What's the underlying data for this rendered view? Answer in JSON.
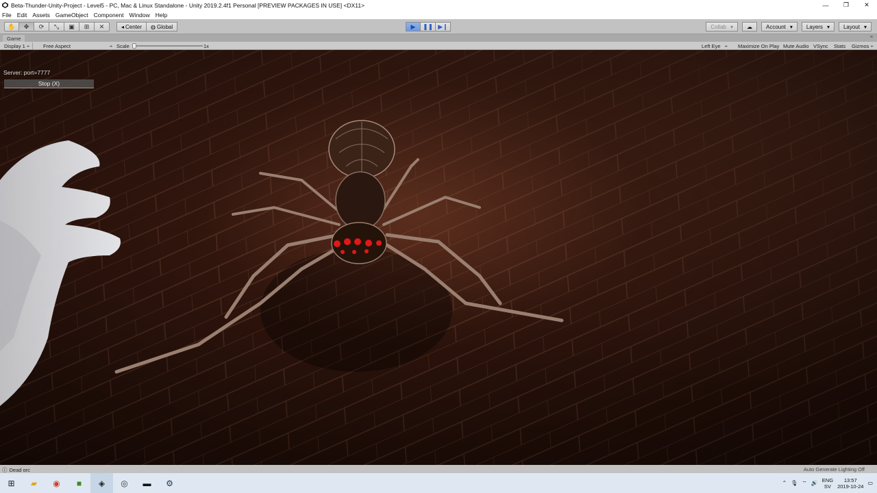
{
  "window": {
    "title": "Beta-Thunder-Unity-Project - Level5 - PC, Mac & Linux Standalone - Unity 2019.2.4f1 Personal [PREVIEW PACKAGES IN USE] <DX11>",
    "minimize": "—",
    "restore": "❐",
    "close": "✕"
  },
  "menu": [
    "File",
    "Edit",
    "Assets",
    "GameObject",
    "Component",
    "Window",
    "Help"
  ],
  "toolbar": {
    "center_label": "Center",
    "global_label": "Global",
    "collab_label": "Collab",
    "account_label": "Account",
    "layers_label": "Layers",
    "layout_label": "Layout"
  },
  "game_tab": {
    "label": "Game"
  },
  "game_bar": {
    "display": "Display 1",
    "aspect": "Free Aspect",
    "scale_label": "Scale",
    "scale_value": "1x",
    "left_eye": "Left Eye",
    "maximize": "Maximize On Play",
    "mute": "Mute Audio",
    "vsync": "VSync",
    "stats": "Stats",
    "gizmos": "Gizmos"
  },
  "hud": {
    "server": "Server: port=7777",
    "stop_button": "Stop (X)"
  },
  "status": {
    "message": "Dead orc",
    "right": "Auto Generate Lighting Off"
  },
  "taskbar": {
    "lang_top": "ENG",
    "lang_bottom": "SV",
    "time": "13:57",
    "date": "2019-10-24"
  },
  "colors": {
    "toolbar": "#c2c2c2",
    "play_active": "#6f98dc",
    "scene_floor": "#3a1a10",
    "spider_eyes": "#e01818"
  }
}
